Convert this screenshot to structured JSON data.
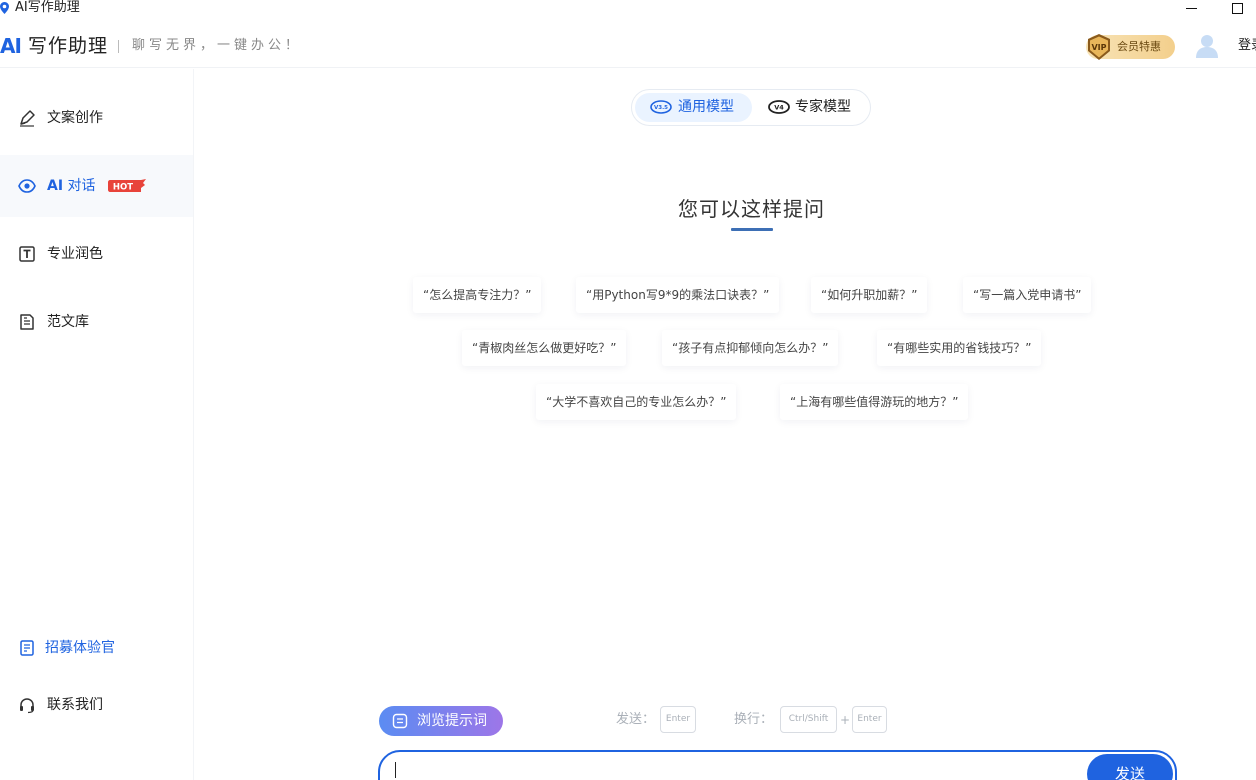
{
  "window": {
    "title": "AI写作助理"
  },
  "header": {
    "logo_ai": "AI",
    "logo_text": "写作助理",
    "slogan": "聊写无界，一键办公！",
    "vip_badge": "VIP",
    "vip_label": "会员特惠",
    "login_label": "登录"
  },
  "sidebar": {
    "items": [
      {
        "label": "文案创作",
        "icon": "pen-icon"
      },
      {
        "label_prefix": "AI",
        "label": "对话",
        "icon": "eye-chat-icon",
        "badge": "HOT"
      },
      {
        "label": "专业润色",
        "icon": "text-box-icon"
      },
      {
        "label": "范文库",
        "icon": "document-icon"
      }
    ],
    "bottom": [
      {
        "label": "招募体验官",
        "icon": "form-icon"
      },
      {
        "label": "联系我们",
        "icon": "headset-icon"
      }
    ]
  },
  "model_toggle": {
    "general": {
      "label": "通用模型",
      "icon_text": "V3.5",
      "selected": true
    },
    "expert": {
      "label": "专家模型",
      "icon_text": "V4",
      "selected": false
    }
  },
  "main": {
    "prompt_title": "您可以这样提问",
    "suggestions": [
      "“怎么提高专注力？”",
      "“用Python写9*9的乘法口诀表？”",
      "“如何升职加薪？”",
      "“写一篇入党申请书”",
      "“青椒肉丝怎么做更好吃？”",
      "“孩子有点抑郁倾向怎么办？”",
      "“有哪些实用的省钱技巧？”",
      "“大学不喜欢自己的专业怎么办？”",
      "“上海有哪些值得游玩的地方？”"
    ]
  },
  "composer": {
    "browse_label": "浏览提示词",
    "send_hint": "发送：",
    "newline_hint": "换行：",
    "key_enter": "Enter",
    "key_ctrl_shift": "Ctrl/Shift",
    "key_plus": "+",
    "send_label": "发送"
  },
  "colors": {
    "accent": "#1f63e0",
    "hot": "#e8433a",
    "vip_gold": "#f3cf8c"
  }
}
